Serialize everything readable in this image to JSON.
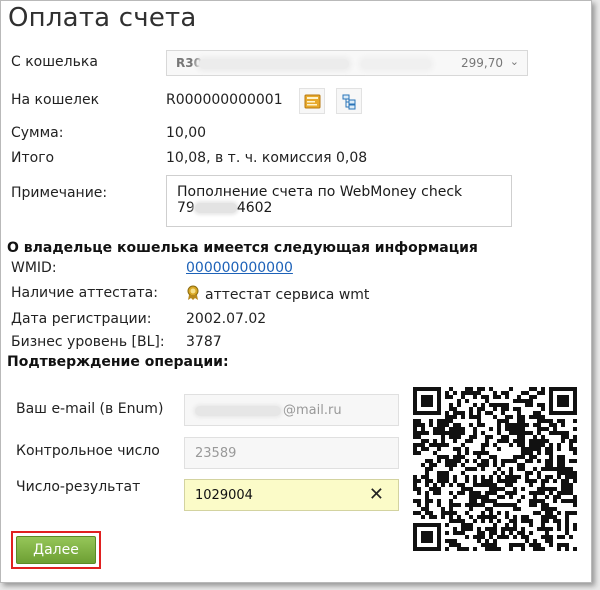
{
  "page": {
    "title": "Оплата счета"
  },
  "form": {
    "from_wallet": {
      "label": "С кошелька",
      "wallet_prefix": "R30",
      "balance": "299,70"
    },
    "to_wallet": {
      "label": "На кошелек",
      "value": "R000000000001"
    },
    "amount": {
      "label": "Сумма:",
      "value": "10,00"
    },
    "total": {
      "label": "Итого",
      "value": "10,08, в т. ч. комиссия 0,08"
    },
    "note": {
      "label": "Примечание:",
      "line1": "Пополнение счета по WebMoney check",
      "line2_prefix": "79",
      "line2_suffix": "4602"
    }
  },
  "owner": {
    "heading": "О владельце кошелька имеется следующая информация",
    "wmid": {
      "label": "WMID:",
      "value": "000000000000"
    },
    "certificate": {
      "label": "Наличие аттестата:",
      "value": "аттестат сервиса wmt"
    },
    "registration": {
      "label": "Дата регистрации:",
      "value": "2002.07.02"
    },
    "business_level": {
      "label": "Бизнес уровень [BL]:",
      "value": "3787"
    }
  },
  "confirm": {
    "heading": "Подтверждение операции:",
    "email": {
      "label": "Ваш e-mail (в Enum)",
      "domain": "@mail.ru"
    },
    "control_number": {
      "label": "Контрольное число",
      "value": "23589"
    },
    "result_number": {
      "label": "Число-результат",
      "value": "1029004"
    },
    "next_button": "Далее"
  },
  "icons": {
    "wallet_book": "address-book-icon",
    "wallet_tree": "tree-icon",
    "certificate": "certificate-seal-icon",
    "clear": "clear-x-icon",
    "qr": "qr-code"
  },
  "colors": {
    "link": "#1d62b8",
    "button": "#7fb23f",
    "highlight_field": "#fbfbc8",
    "annotation": "#e02020"
  }
}
